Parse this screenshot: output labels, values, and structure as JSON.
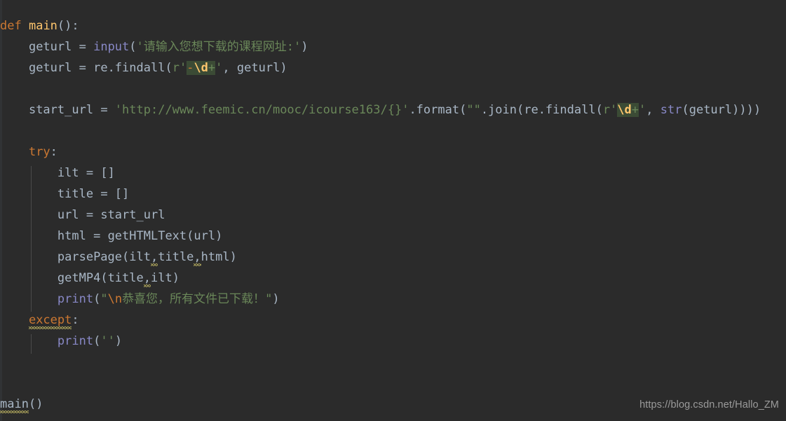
{
  "editor": {
    "background_color": "#2b2b2b",
    "gutter_color": "#313335",
    "indent_guide_color": "#4b4b4b",
    "language": "Python"
  },
  "colors": {
    "keyword": "#cc7832",
    "function_name": "#ffc66d",
    "identifier": "#a9b7c6",
    "builtin": "#8888c6",
    "string": "#6a8759",
    "escape": "#cc7832",
    "regex_highlight_bg": "#3b4b35",
    "regex_class": "#ffc66d",
    "warning_squiggle": "#a9a05a",
    "watermark": "#9b9b9b"
  },
  "code": {
    "line1": {
      "kw_def": "def",
      "name": "main",
      "tail": "():"
    },
    "line2": {
      "indent": "    ",
      "var": "geturl",
      "eq": " = ",
      "builtin": "input",
      "open": "(",
      "string": "'请输入您想下载的课程网址:'",
      "close": ")"
    },
    "line3": {
      "indent": "    ",
      "var": "geturl",
      "eq": " = ",
      "call": "re.findall",
      "open": "(",
      "prefix": "r'",
      "rx_meta": "-",
      "rx_class": "\\d",
      "rx_quant": "+",
      "quote": "'",
      "args": ", geturl",
      "close": ")"
    },
    "line4": {
      "text": ""
    },
    "line5": {
      "indent": "    ",
      "var": "start_url",
      "eq": " = ",
      "string": "'http://www.feemic.cn/mooc/icourse163/{}'",
      "dot_format": ".format(",
      "empty_string": "\"\"",
      "join": ".join(re.findall(",
      "prefix": "r'",
      "rx_class": "\\d",
      "rx_quant": "+",
      "quote": "'",
      "comma": ", ",
      "builtin": "str",
      "tail": "(geturl))))"
    },
    "line6": {
      "text": ""
    },
    "line7": {
      "indent": "    ",
      "kw": "try",
      "colon": ":"
    },
    "line8": {
      "indent": "        ",
      "var": "ilt",
      "eq": " = ",
      "value": "[]"
    },
    "line9": {
      "indent": "        ",
      "var": "title",
      "eq": " = ",
      "value": "[]"
    },
    "line10": {
      "indent": "        ",
      "var": "url",
      "eq": " = ",
      "value": "start_url"
    },
    "line11": {
      "indent": "        ",
      "var": "html",
      "eq": " = ",
      "call": "getHTMLText(url)"
    },
    "line12": {
      "indent": "        ",
      "call": "parsePage",
      "open": "(",
      "arg1": "ilt",
      "comma1": ",",
      "arg2": "title",
      "comma2": ",",
      "arg3": "html",
      "close": ")"
    },
    "line13": {
      "indent": "        ",
      "call": "getMP4",
      "open": "(",
      "arg1": "title",
      "comma1": ",",
      "arg2": "ilt",
      "close": ")"
    },
    "line14": {
      "indent": "        ",
      "builtin": "print",
      "open": "(",
      "quote_open": "\"",
      "escape": "\\n",
      "string": "恭喜您，所有文件已下载！",
      "quote_close": "\"",
      "close": ")"
    },
    "line15": {
      "indent": "    ",
      "kw": "except",
      "colon": ":"
    },
    "line16": {
      "indent": "        ",
      "builtin": "print",
      "open": "(",
      "string": "''",
      "close": ")"
    },
    "line17": {
      "text": ""
    },
    "line18": {
      "text": ""
    },
    "line19": {
      "call": "main",
      "parens": "()"
    }
  },
  "watermark": {
    "text": "https://blog.csdn.net/Hallo_ZM"
  }
}
